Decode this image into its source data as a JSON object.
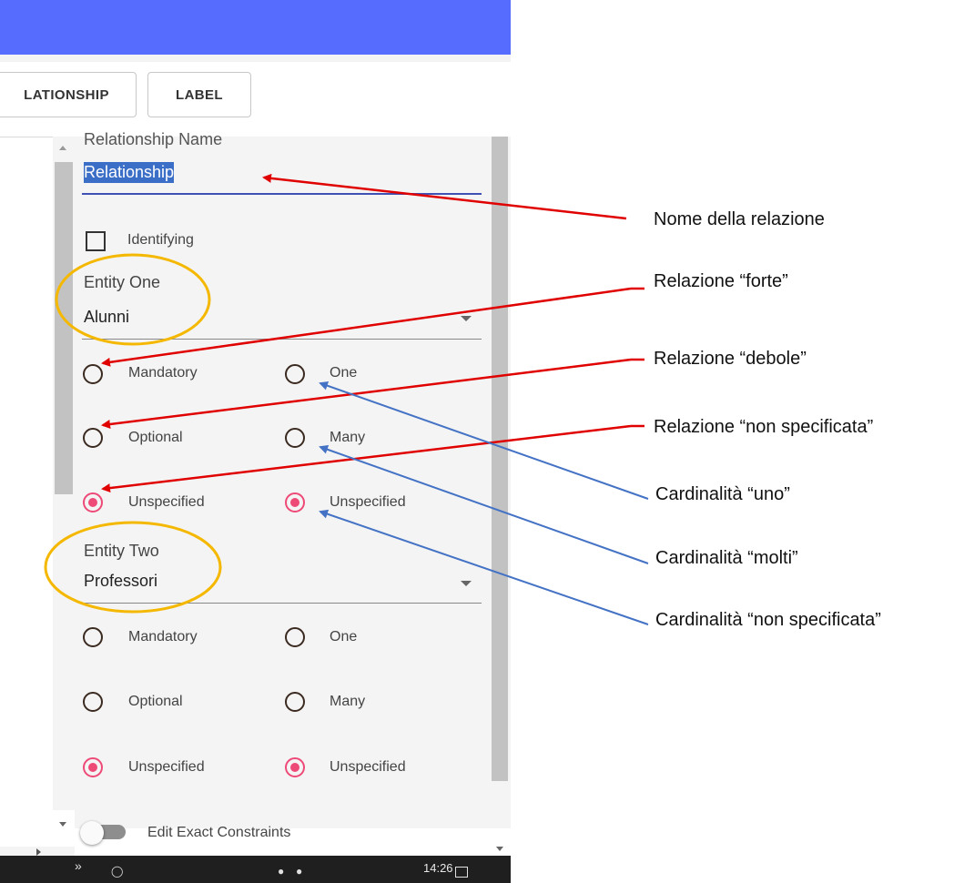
{
  "colors": {
    "topbar": "#556cff",
    "accent_blue": "#3f51b5",
    "radio_selected": "#ee4a78",
    "arrow_red": "#e00000",
    "arrow_blue": "#4472c4",
    "ellipse_gold": "#f5b800"
  },
  "toolbar": {
    "relationship_button": "LATIONSHIP",
    "label_button": "LABEL"
  },
  "panel": {
    "relationship_name_label": "Relationship Name",
    "relationship_name_value": "Relationship",
    "identifying_label": "Identifying",
    "identifying_checked": false,
    "entity_one": {
      "label": "Entity One",
      "value": "Alunni",
      "optionality": [
        "Mandatory",
        "Optional",
        "Unspecified"
      ],
      "cardinality": [
        "One",
        "Many",
        "Unspecified"
      ],
      "selected_optionality": "Unspecified",
      "selected_cardinality": "Unspecified"
    },
    "entity_two": {
      "label": "Entity Two",
      "value": "Professori",
      "optionality": [
        "Mandatory",
        "Optional",
        "Unspecified"
      ],
      "cardinality": [
        "One",
        "Many",
        "Unspecified"
      ],
      "selected_optionality": "Unspecified",
      "selected_cardinality": "Unspecified"
    },
    "edit_exact_constraints_label": "Edit Exact Constraints",
    "edit_exact_constraints_on": false
  },
  "taskbar": {
    "chevron": "»",
    "time": "14:26"
  },
  "annotations": {
    "relation_name": "Nome della relazione",
    "strong": "Relazione “forte”",
    "weak": "Relazione “debole”",
    "unspecified_rel": "Relazione “non specificata”",
    "card_one": "Cardinalità “uno”",
    "card_many": "Cardinalità “molti”",
    "card_unspecified": "Cardinalità “non specificata”"
  }
}
